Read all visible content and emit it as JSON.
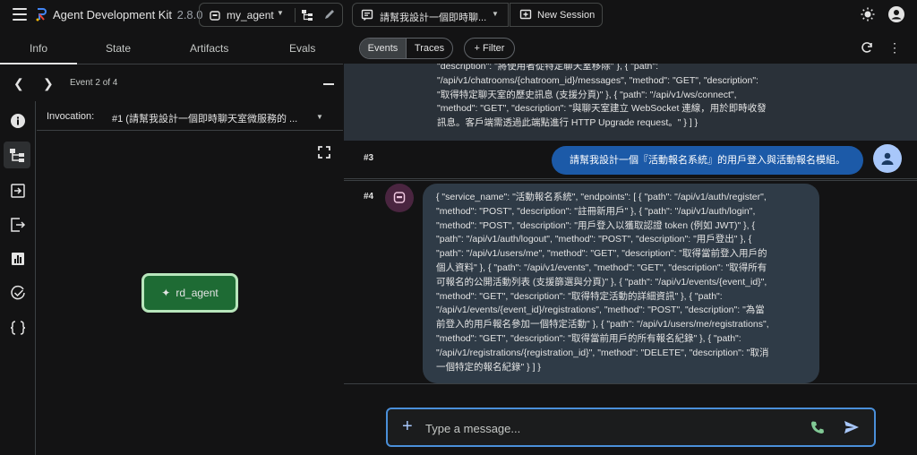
{
  "app": {
    "title": "Agent Development Kit",
    "version": "2.8.0"
  },
  "agent_select": {
    "value": "my_agent"
  },
  "session_select": {
    "value": "請幫我設計一個即時聊..."
  },
  "new_session": {
    "label": "New Session"
  },
  "left_tabs": [
    "Info",
    "State",
    "Artifacts",
    "Evals"
  ],
  "event_nav": {
    "label": "Event 2 of 4"
  },
  "invocation": {
    "label": "Invocation:",
    "value": "#1 (請幫我設計一個即時聊天室微服務的 ..."
  },
  "graph": {
    "node_label": "rd_agent"
  },
  "events_toolbar": {
    "events_label": "Events",
    "traces_label": "Traces",
    "filter_label": "Filter"
  },
  "events": [
    {
      "id": "",
      "lines": [
        "\"description\": \"將使用者從特定聊天室移除\" }, { \"path\":",
        "\"/api/v1/chatrooms/{chatroom_id}/messages\", \"method\": \"GET\", \"description\":",
        "\"取得特定聊天室的歷史訊息 (支援分頁)\" }, { \"path\": \"/api/v1/ws/connect\",",
        "\"method\": \"GET\", \"description\": \"與聊天室建立 WebSocket 連線，用於即時收發",
        "訊息。客戶端需透過此端點進行 HTTP Upgrade request。\" } ] }"
      ]
    },
    {
      "id": "#3",
      "text": "請幫我設計一個『活動報名系統』的用戶登入與活動報名模組。"
    },
    {
      "id": "#4",
      "lines": [
        "{ \"service_name\": \"活動報名系統\", \"endpoints\": [ { \"path\": \"/api/v1/auth/register\",",
        "\"method\": \"POST\", \"description\": \"註冊新用戶\" }, { \"path\": \"/api/v1/auth/login\",",
        "\"method\": \"POST\", \"description\": \"用戶登入以獲取認證 token (例如 JWT)\" }, {",
        "\"path\": \"/api/v1/auth/logout\", \"method\": \"POST\", \"description\": \"用戶登出\" }, {",
        "\"path\": \"/api/v1/users/me\", \"method\": \"GET\", \"description\": \"取得當前登入用戶的",
        "個人資料\" }, { \"path\": \"/api/v1/events\", \"method\": \"GET\", \"description\": \"取得所有",
        "可報名的公開活動列表 (支援篩選與分頁)\" }, { \"path\": \"/api/v1/events/{event_id}\",",
        "\"method\": \"GET\", \"description\": \"取得特定活動的詳細資訊\" }, { \"path\":",
        "\"/api/v1/events/{event_id}/registrations\", \"method\": \"POST\", \"description\": \"為當",
        "前登入的用戶報名參加一個特定活動\" }, { \"path\": \"/api/v1/users/me/registrations\",",
        "\"method\": \"GET\", \"description\": \"取得當前用戶的所有報名紀錄\" }, { \"path\":",
        "\"/api/v1/registrations/{registration_id}\", \"method\": \"DELETE\", \"description\": \"取消",
        "一個特定的報名紀錄\" } ] }"
      ]
    }
  ],
  "composer": {
    "placeholder": "Type a message..."
  },
  "colors": {
    "accent": "#4a8fd9",
    "user_bubble": "#1c5aa8",
    "bot_bubble": "#2f3b47",
    "node_fill": "#1e6b34",
    "node_border": "#b8e6bc"
  },
  "icons": [
    "menu-icon",
    "adk-logo-icon",
    "bot-icon",
    "tree-icon",
    "pencil-icon",
    "chat-icon",
    "new-session-icon",
    "sun-icon",
    "account-icon",
    "info-icon",
    "graph-icon",
    "login-icon",
    "logout-icon",
    "chart-icon",
    "check-circle-icon",
    "braces-icon",
    "fullscreen-icon",
    "refresh-icon",
    "user-icon",
    "phone-icon",
    "send-icon"
  ]
}
